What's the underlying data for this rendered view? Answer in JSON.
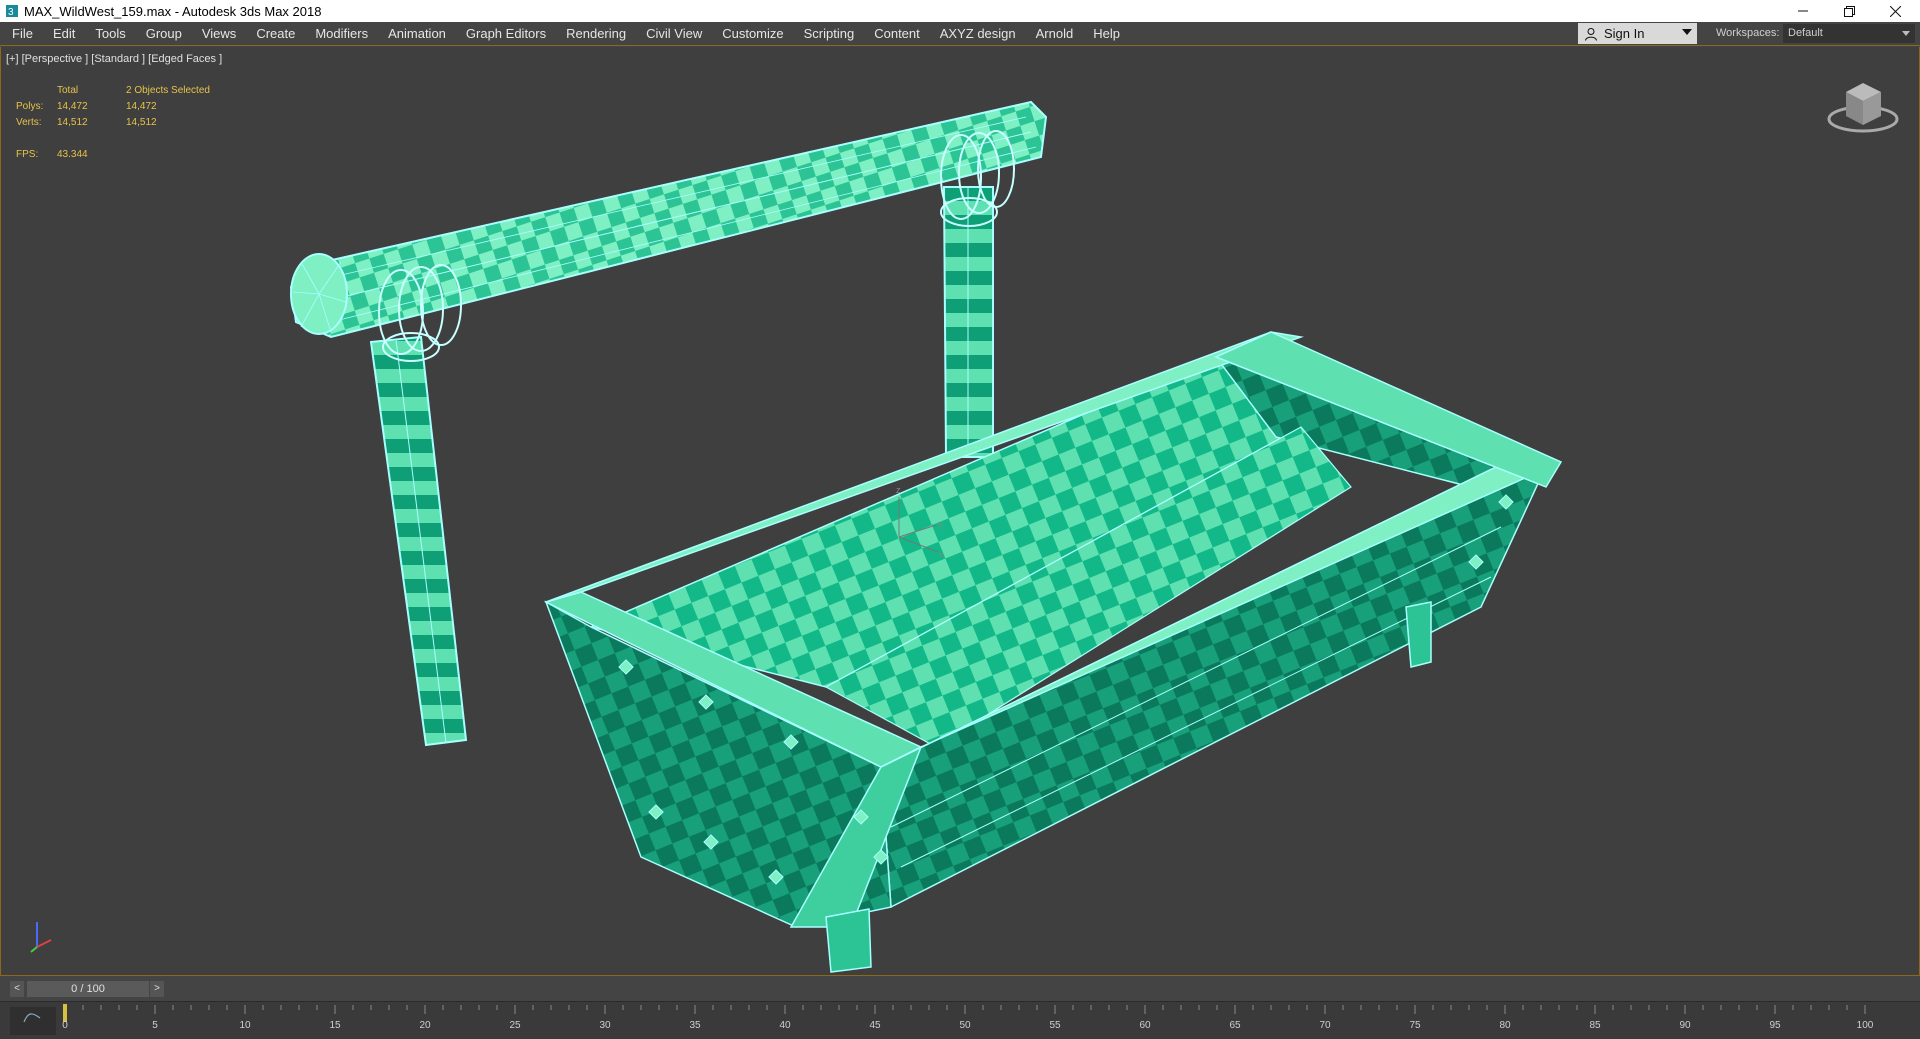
{
  "window": {
    "title": "MAX_WildWest_159.max - Autodesk 3ds Max 2018",
    "minimize_icon": "minimize-icon",
    "restore_icon": "restore-icon",
    "close_icon": "close-icon"
  },
  "menubar": {
    "items": [
      "File",
      "Edit",
      "Tools",
      "Group",
      "Views",
      "Create",
      "Modifiers",
      "Animation",
      "Graph Editors",
      "Rendering",
      "Civil View",
      "Customize",
      "Scripting",
      "Content",
      "AXYZ design",
      "Arnold",
      "Help"
    ],
    "sign_in": "Sign In",
    "workspaces_label": "Workspaces:",
    "workspace_value": "Default"
  },
  "viewport": {
    "label": "[+] [Perspective ] [Standard ] [Edged Faces ]",
    "stats": {
      "col_total": "Total",
      "col_selected": "2 Objects Selected",
      "polys_label": "Polys:",
      "polys_total": "14,472",
      "polys_selected": "14,472",
      "verts_label": "Verts:",
      "verts_total": "14,512",
      "verts_selected": "14,512",
      "fps_label": "FPS:",
      "fps_value": "43.344"
    },
    "gizmo_x": "x",
    "gizmo_y": "y",
    "gizmo_z": "z",
    "colors": {
      "checker_light": "#5fe0b0",
      "checker_dark": "#0a9a72",
      "wire": "#a8ffff",
      "background": "#3f3f3f"
    }
  },
  "timeline": {
    "slider_text": "0 / 100",
    "prev_label": "<",
    "next_label": ">",
    "ticks": [
      "0",
      "5",
      "10",
      "15",
      "20",
      "25",
      "30",
      "35",
      "40",
      "45",
      "50",
      "55",
      "60",
      "65",
      "70",
      "75",
      "80",
      "85",
      "90",
      "95",
      "100"
    ]
  }
}
